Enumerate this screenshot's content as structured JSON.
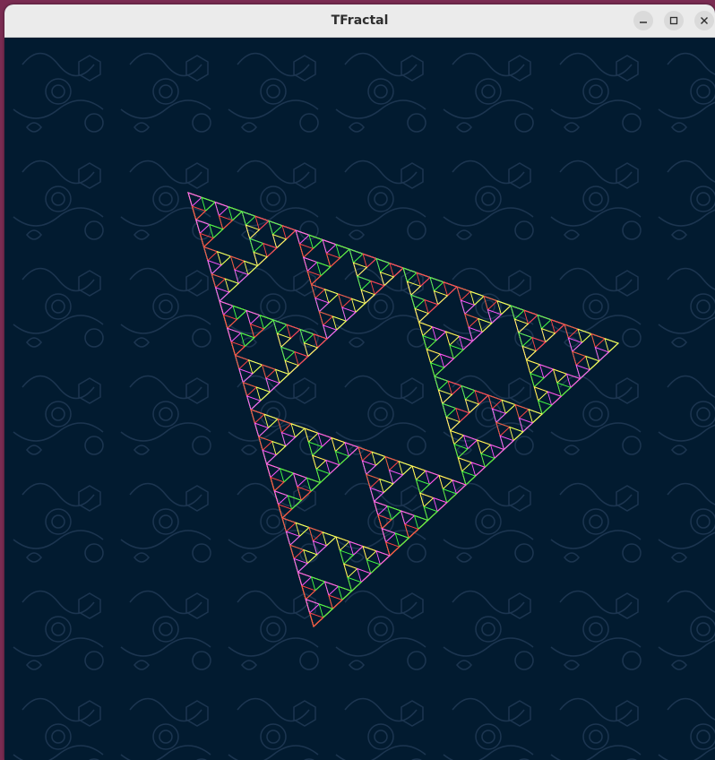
{
  "window": {
    "title": "TFractal",
    "controls": {
      "minimize": "minimize-icon",
      "maximize": "maximize-icon",
      "close": "close-icon"
    }
  },
  "canvas": {
    "background_color": "#021b30",
    "pattern_color": "#1c3550",
    "fractal": {
      "type": "sierpinski-triangle",
      "orientation": "inverted",
      "depth": 5,
      "palette": [
        "#ff4444",
        "#44ff44",
        "#4488ff",
        "#ffff55",
        "#ff55ff",
        "#55ffff",
        "#ffffff",
        "#ff9933",
        "#9955ff",
        "#33ff99"
      ]
    }
  }
}
